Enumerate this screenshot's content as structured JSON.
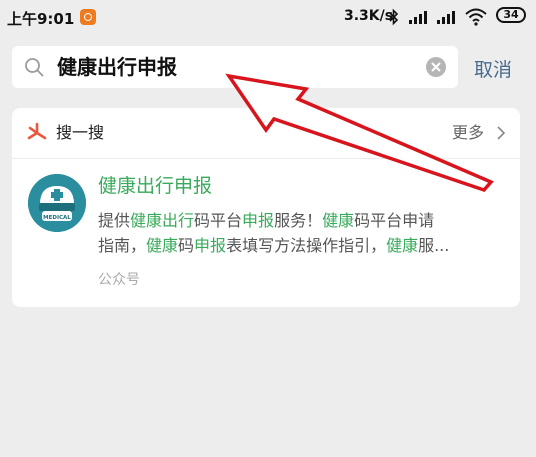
{
  "status_bar": {
    "time": "上午9:01",
    "speed": "3.3K/s",
    "battery": "34"
  },
  "search": {
    "query": "健康出行申报",
    "cancel_label": "取消"
  },
  "results": {
    "section_label": "搜一搜",
    "more_label": "更多",
    "item": {
      "title": "健康出行申报",
      "avatar_text": "MEDICAL",
      "desc_line1": [
        {
          "text": "提供",
          "hl": false
        },
        {
          "text": "健康出行",
          "hl": true
        },
        {
          "text": "码平台",
          "hl": false
        },
        {
          "text": "申报",
          "hl": true
        },
        {
          "text": "服务！",
          "hl": false
        },
        {
          "text": "健康",
          "hl": true
        },
        {
          "text": "码平台申请",
          "hl": false
        }
      ],
      "desc_line2": [
        {
          "text": "指南，",
          "hl": false
        },
        {
          "text": "健康",
          "hl": true
        },
        {
          "text": "码",
          "hl": false
        },
        {
          "text": "申报",
          "hl": true
        },
        {
          "text": "表填写方法操作指引，",
          "hl": false
        },
        {
          "text": "健康",
          "hl": true
        },
        {
          "text": "服...",
          "hl": false
        }
      ],
      "source": "公众号"
    }
  },
  "colors": {
    "highlight": "#3aaa5c",
    "cancel": "#4a6b8f",
    "arrow": "#d8141c"
  }
}
